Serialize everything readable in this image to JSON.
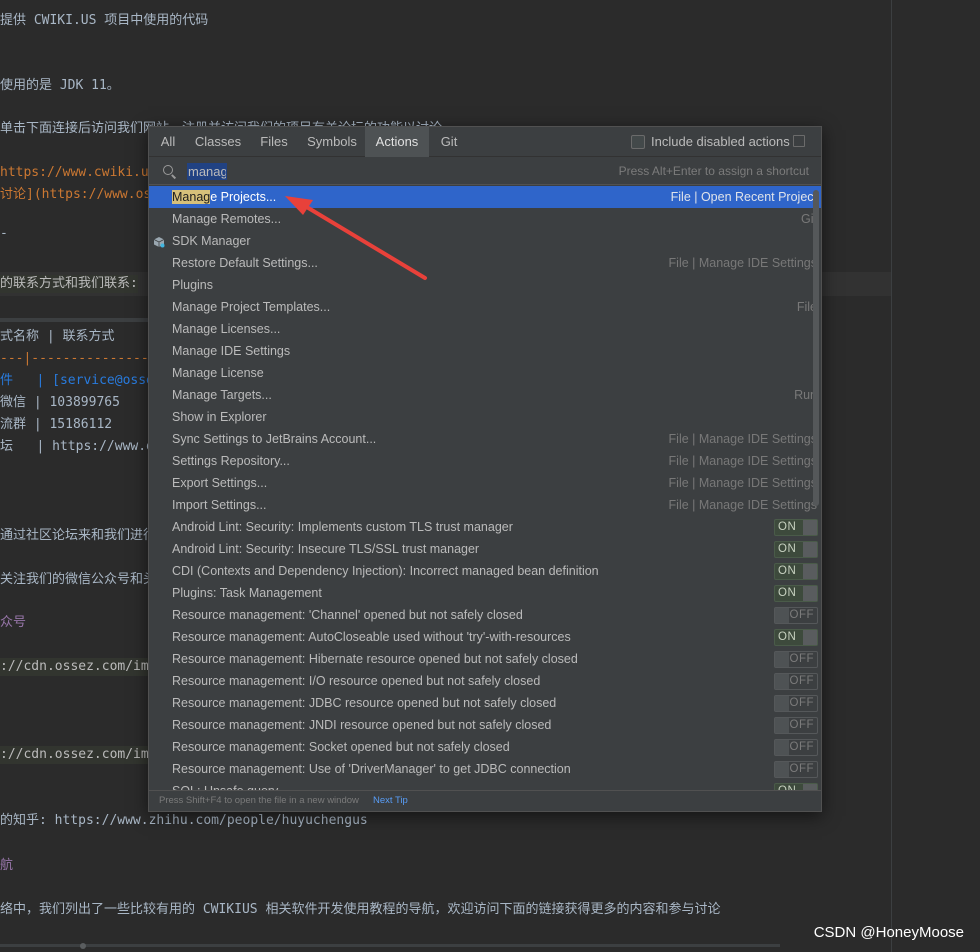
{
  "editor": {
    "lines": [
      {
        "text": "提供 CWIKI.US 项目中使用的代码",
        "cls": ""
      },
      {
        "text": "使用的是 JDK 11。",
        "cls": ""
      },
      {
        "text": "单击下面连接后访问我们网站，注册并访问我们的项目有关论坛的功能以讨论",
        "cls": ""
      },
      {
        "text": "https://www.cwiki.us",
        "cls": "strong"
      },
      {
        "text": "讨论](https://www.ossez.com",
        "cls": "strong"
      },
      {
        "text": "-",
        "cls": ""
      },
      {
        "text": "的联系方式和我们联系:",
        "cls": "hl"
      },
      {
        "text": "式名称 | 联系方式",
        "cls": ""
      },
      {
        "text": "---|----------------------",
        "cls": "strong"
      },
      {
        "text": "件   | [service@ossez.com",
        "cls": "link"
      },
      {
        "text": "微信 | 103899765",
        "cls": ""
      },
      {
        "text": "流群 | 15186112",
        "cls": ""
      },
      {
        "text": "坛   | https://www.ossez.com",
        "cls": ""
      },
      {
        "text": "通过社区论坛来和我们进行交流",
        "cls": ""
      },
      {
        "text": "关注我们的微信公众号和头条号",
        "cls": ""
      },
      {
        "text": "众号",
        "cls": "comment"
      },
      {
        "text": "://cdn.ossez.com/img/",
        "cls": "hl"
      },
      {
        "text": "://cdn.ossez.com/img/",
        "cls": "hl"
      },
      {
        "text": "的知乎: https://www.zhihu.com/people/huyuchengus",
        "cls": ""
      },
      {
        "text": "航",
        "cls": "comment"
      },
      {
        "text": "络中，我们列出了一些比较有用的 CWIKIUS 相关软件开发使用教程的导航，欢迎访问下面的链接获得更多的内容和参与讨论",
        "cls": ""
      }
    ],
    "watermark": "CSDN @HoneyMoose"
  },
  "popup": {
    "tabs": [
      "All",
      "Classes",
      "Files",
      "Symbols",
      "Actions",
      "Git"
    ],
    "active_tab": "Actions",
    "include_disabled_label": "Include disabled actions",
    "search": {
      "value": "manag",
      "hint": "Press Alt+Enter to assign a shortcut"
    },
    "results": [
      {
        "label_match": "Manag",
        "label_rest": "e Projects...",
        "location": "File | Open Recent Project",
        "selected": true
      },
      {
        "label_match": "",
        "label_rest": "Manage Remotes...",
        "location": "Git"
      },
      {
        "label_match": "",
        "label_rest": "SDK Manager",
        "location": "",
        "icon": "sdk-manager-icon"
      },
      {
        "label_match": "",
        "label_rest": "Restore Default Settings...",
        "location": "File | Manage IDE Settings"
      },
      {
        "label_match": "",
        "label_rest": "Plugins",
        "location": ""
      },
      {
        "label_match": "",
        "label_rest": "Manage Project Templates...",
        "location": "File"
      },
      {
        "label_match": "",
        "label_rest": "Manage Licenses...",
        "location": ""
      },
      {
        "label_match": "",
        "label_rest": "Manage IDE Settings",
        "location": ""
      },
      {
        "label_match": "",
        "label_rest": "Manage License",
        "location": ""
      },
      {
        "label_match": "",
        "label_rest": "Manage Targets...",
        "location": "Run"
      },
      {
        "label_match": "",
        "label_rest": "Show in Explorer",
        "location": ""
      },
      {
        "label_match": "",
        "label_rest": "Sync Settings to JetBrains Account...",
        "location": "File | Manage IDE Settings"
      },
      {
        "label_match": "",
        "label_rest": "Settings Repository...",
        "location": "File | Manage IDE Settings"
      },
      {
        "label_match": "",
        "label_rest": "Export Settings...",
        "location": "File | Manage IDE Settings"
      },
      {
        "label_match": "",
        "label_rest": "Import Settings...",
        "location": "File | Manage IDE Settings"
      },
      {
        "label_match": "",
        "label_rest": "Android Lint: Security: Implements custom TLS trust manager",
        "toggle": "ON"
      },
      {
        "label_match": "",
        "label_rest": "Android Lint: Security: Insecure TLS/SSL trust manager",
        "toggle": "ON"
      },
      {
        "label_match": "",
        "label_rest": "CDI (Contexts and Dependency Injection): Incorrect managed bean definition",
        "toggle": "ON"
      },
      {
        "label_match": "",
        "label_rest": "Plugins: Task Management",
        "toggle": "ON"
      },
      {
        "label_match": "",
        "label_rest": "Resource management: 'Channel' opened but not safely closed",
        "toggle": "OFF"
      },
      {
        "label_match": "",
        "label_rest": "Resource management: AutoCloseable used without 'try'-with-resources",
        "toggle": "ON"
      },
      {
        "label_match": "",
        "label_rest": "Resource management: Hibernate resource opened but not safely closed",
        "toggle": "OFF"
      },
      {
        "label_match": "",
        "label_rest": "Resource management: I/O resource opened but not safely closed",
        "toggle": "OFF"
      },
      {
        "label_match": "",
        "label_rest": "Resource management: JDBC resource opened but not safely closed",
        "toggle": "OFF"
      },
      {
        "label_match": "",
        "label_rest": "Resource management: JNDI resource opened but not safely closed",
        "toggle": "OFF"
      },
      {
        "label_match": "",
        "label_rest": "Resource management: Socket opened but not safely closed",
        "toggle": "OFF"
      },
      {
        "label_match": "",
        "label_rest": "Resource management: Use of 'DriverManager' to get JDBC connection",
        "toggle": "OFF"
      },
      {
        "label_match": "",
        "label_rest": "SQL: Unsafe query",
        "toggle": "ON"
      }
    ],
    "footer": {
      "text": "Press Shift+F4 to open the file in a new window",
      "link": "Next Tip"
    }
  },
  "colors": {
    "selection": "#2f65ca",
    "annotation_arrow": "#e8413a"
  }
}
